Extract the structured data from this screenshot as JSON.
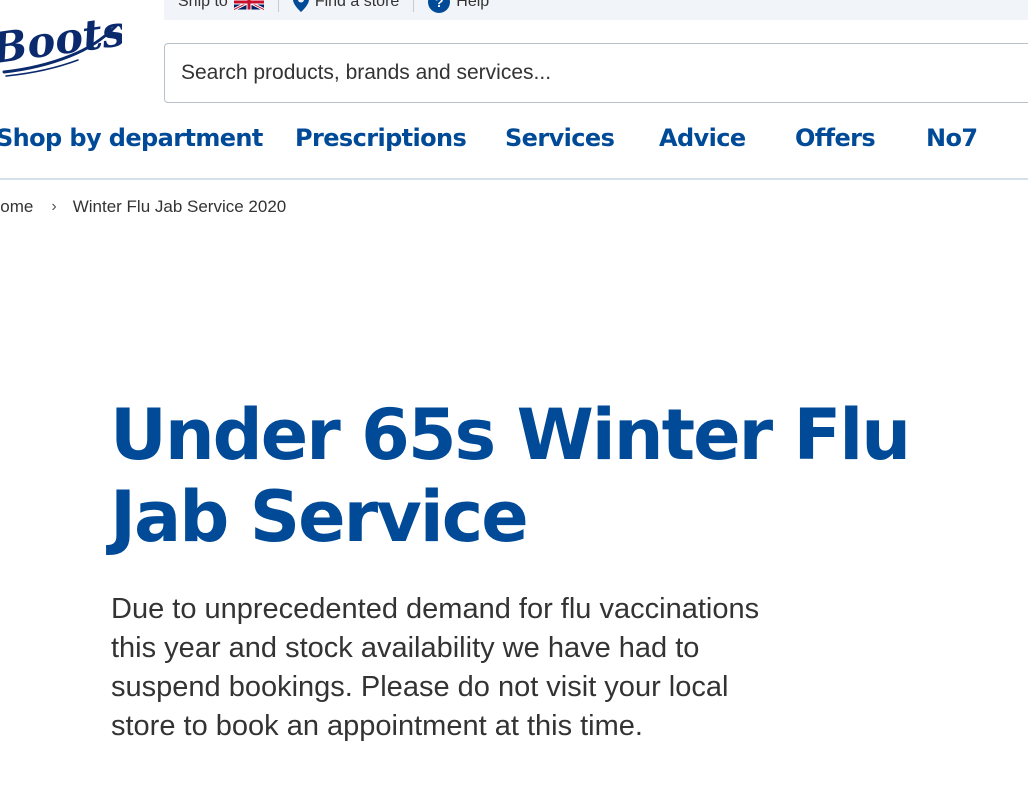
{
  "utility_bar": {
    "ship_to_label": "Ship to",
    "find_store_label": "Find a store",
    "help_label": "Help"
  },
  "logo": {
    "text": "Boots"
  },
  "search": {
    "placeholder": "Search products, brands and services..."
  },
  "nav": {
    "items": [
      {
        "label": "Shop by department"
      },
      {
        "label": "Prescriptions"
      },
      {
        "label": "Services"
      },
      {
        "label": "Advice"
      },
      {
        "label": "Offers"
      },
      {
        "label": "No7"
      }
    ]
  },
  "breadcrumb": {
    "home_label": "Home",
    "current_label": "Winter Flu Jab Service 2020"
  },
  "page": {
    "title": "Under 65s Winter Flu Jab Service",
    "intro": "Due to unprecedented demand for flu vaccinations this year and stock availability we have had to suspend bookings. Please do not visit your local store to book an appointment at this time."
  },
  "colors": {
    "brand_blue": "#004a97",
    "text_dark": "#333333",
    "utility_bg": "#f1f4f8",
    "nav_border": "#d3e1eb"
  },
  "icons": {
    "flag": "uk-flag-icon",
    "store": "location-pin-icon",
    "help": "help-icon",
    "breadcrumb_separator": "chevron-right-icon"
  }
}
